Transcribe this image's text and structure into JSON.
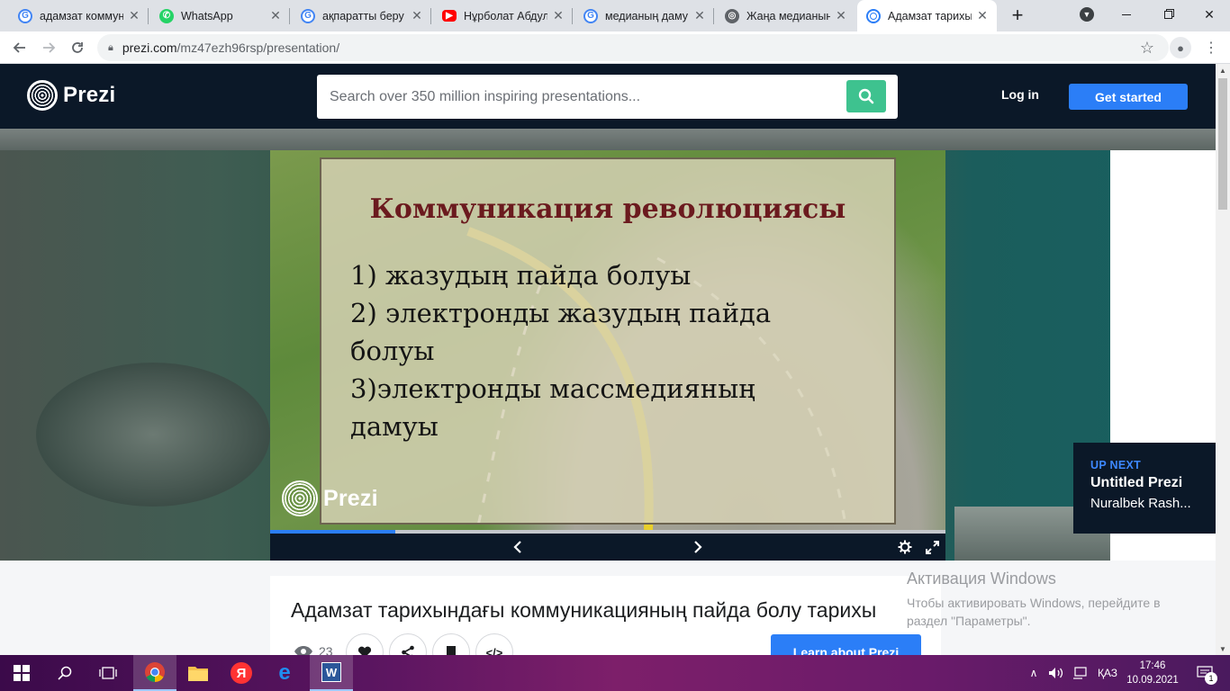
{
  "browser": {
    "tabs": [
      {
        "title": "адамзат коммуни",
        "icon": "google-icon",
        "icon_color": "#4285f4",
        "active": false
      },
      {
        "title": "WhatsApp",
        "icon": "whatsapp-icon",
        "icon_color": "#25d366",
        "active": false
      },
      {
        "title": "ақпаратты беру ж",
        "icon": "google-icon",
        "icon_color": "#4285f4",
        "active": false
      },
      {
        "title": "Нұрболат Абдул",
        "icon": "youtube-icon",
        "icon_color": "#ff0000",
        "active": false
      },
      {
        "title": "медианың даму т",
        "icon": "google-icon",
        "icon_color": "#4285f4",
        "active": false
      },
      {
        "title": "Жаңа медианың",
        "icon": "site-icon",
        "icon_color": "#5f6368",
        "active": false
      },
      {
        "title": "Адамзат тарихын",
        "icon": "prezi-icon",
        "icon_color": "#2b7ef7",
        "active": true
      }
    ],
    "new_tab_label": "+",
    "url_host": "prezi.com",
    "url_path": "/mz47ezh96rsp/presentation/"
  },
  "header": {
    "logo_text": "Prezi",
    "search_placeholder": "Search over 350 million inspiring presentations...",
    "login_label": "Log in",
    "get_started_label": "Get started",
    "accent": "#2b7ef7",
    "search_button_color": "#3ec28f"
  },
  "slide": {
    "title": "Коммуникация революциясы",
    "lines": [
      "1) жазудың пайда болуы",
      "2) электронды жазудың пайда",
      "болуы",
      "3)электронды массмедияның",
      "дамуы"
    ],
    "logo_text": "Prezi",
    "progress": 0.185
  },
  "upnext": {
    "label": "UP NEXT",
    "title": "Untitled Prezi",
    "author": "Nuralbek Rash..."
  },
  "presentation": {
    "title": "Адамзат тарихындағы коммуникацияның пайда болу тарихы",
    "views": "23",
    "learn_label": "Learn about Prezi"
  },
  "watermark": {
    "line1": "Активация Windows",
    "line2": "Чтобы активировать Windows, перейдите в раздел \"Параметры\"."
  },
  "taskbar": {
    "language": "ҚАЗ",
    "time": "17:46",
    "date": "10.09.2021",
    "notifications": "1"
  }
}
